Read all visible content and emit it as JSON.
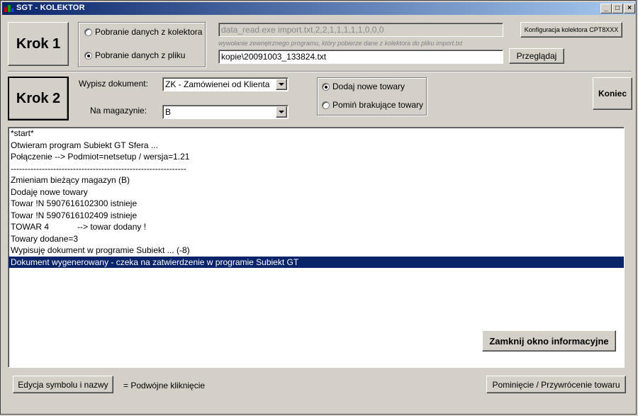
{
  "window": {
    "title": "SGT - KOLEKTOR",
    "controls": {
      "minimize": "_",
      "maximize": "□",
      "close": "×"
    }
  },
  "step1": {
    "button_label": "Krok 1",
    "radio_collector": "Pobranie danych z kolektora",
    "radio_file": "Pobranie danych z pliku",
    "selected": "file",
    "command_value": "data_read.exe import.txt,2,2,1,1,1,1,1,0,0,0",
    "command_hint": "wywołanie zewnętrznego programu, który pobierze dane z kolektora do pliku import.txt",
    "file_value": "kopie\\20091003_133824.txt",
    "browse_label": "Przeglądaj",
    "config_label": "Konfiguracja kolektora CPT8XXX"
  },
  "step2": {
    "button_label": "Krok 2",
    "document_label": "Wypisz dokument:",
    "document_value": "ZK - Zamówienei od Klienta",
    "warehouse_label": "Na magazynie:",
    "warehouse_value": "B",
    "radio_add": "Dodaj nowe towary",
    "radio_skip": "Pomiń brakujące towary",
    "selected": "add",
    "end_label": "Koniec"
  },
  "log": {
    "lines": [
      "*start*",
      "Otwieram program Subiekt GT Sfera ...",
      "Połączenie --> Podmiot=netsetup / wersja=1.21",
      "--------------------------------------------------------------",
      "Zmieniam bieżący magazyn (B)",
      "Dodaję nowe towary",
      "Towar !N 5907616102300 istnieje",
      "Towar !N 5907616102409 istnieje",
      "TOWAR 4            --> towar dodany !",
      "Towary dodane=3",
      "Wypisuję dokument w programie Subiekt ... (-8)",
      "Dokument wygenerowany - czeka na zatwierdzenie w programie Subiekt GT"
    ],
    "selected_index": 11,
    "close_label": "Zamknij okno informacyjne"
  },
  "footer": {
    "edit_label": "Edycja symbolu i nazwy",
    "edit_hint": "= Podwójne kliknięcie",
    "skip_label": "Pominięcie / Przywrócenie towaru"
  },
  "colors": {
    "face": "#d4d0c8",
    "selection": "#0a246a",
    "title_start": "#0a246a",
    "title_end": "#a6caf0"
  }
}
